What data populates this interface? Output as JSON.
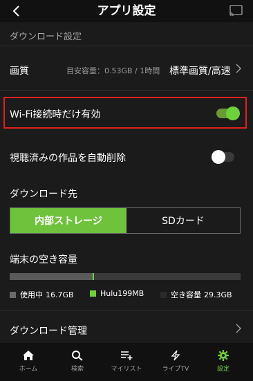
{
  "header": {
    "title": "アプリ設定",
    "back_icon": "back-chevron-icon",
    "cast_icon": "cast-icon"
  },
  "download_settings": {
    "section_label": "ダウンロード設定",
    "quality": {
      "label": "画質",
      "estimate": "目安容量：0.53GB / 1時間",
      "value": "標準画質/高速"
    },
    "wifi_only": {
      "label": "Wi-Fi接続時だけ有効",
      "enabled": true
    },
    "auto_delete": {
      "label": "視聴済みの作品を自動削除",
      "enabled": false
    },
    "destination": {
      "label": "ダウンロード先",
      "options": [
        "内部ストレージ",
        "SDカード"
      ],
      "selected": "内部ストレージ"
    },
    "free_space": {
      "label": "端末の空き容量",
      "used_label": "使用中",
      "used_value": "16.7GB",
      "hulu_label": "Hulu",
      "hulu_value": "199MB",
      "free_label": "空き容量",
      "free_value": "29.3GB",
      "used_fraction": 0.36,
      "hulu_fraction": 0.004,
      "colors": {
        "used": "#5a5a5a",
        "hulu": "#6fd13a",
        "free": "#3a3a3a"
      }
    },
    "manage": {
      "label": "ダウンロード管理"
    }
  },
  "tabbar": {
    "items": [
      {
        "label": "ホーム",
        "icon": "home-icon"
      },
      {
        "label": "検索",
        "icon": "search-icon"
      },
      {
        "label": "マイリスト",
        "icon": "mylist-icon"
      },
      {
        "label": "ライブTV",
        "icon": "live-tv-icon"
      },
      {
        "label": "設定",
        "icon": "gear-icon",
        "active": true
      }
    ]
  },
  "accent_color": "#6fd13a",
  "highlight_color": "#e0201e"
}
